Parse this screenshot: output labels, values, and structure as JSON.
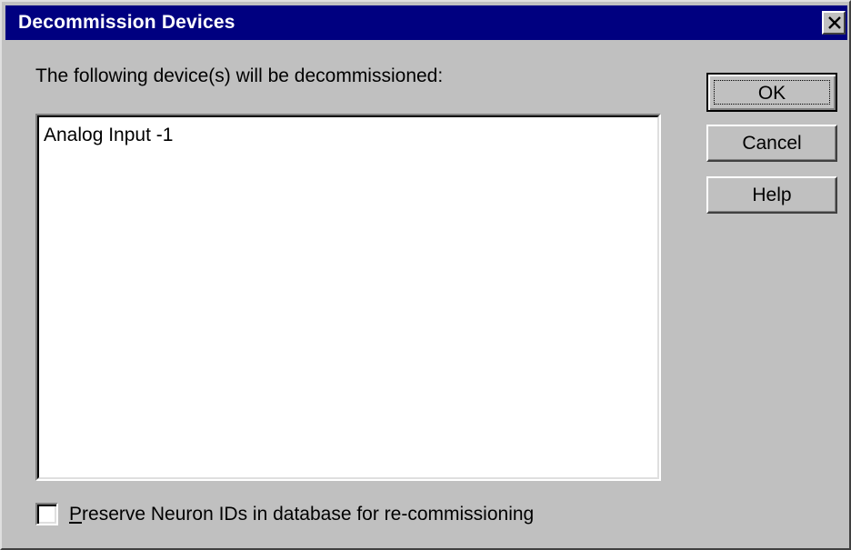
{
  "window": {
    "title": "Decommission Devices",
    "close_glyph": "close-icon"
  },
  "prompt": "The following device(s) will be decommissioned:",
  "devices": [
    "Analog Input -1"
  ],
  "buttons": {
    "ok": "OK",
    "cancel": "Cancel",
    "help": "Help"
  },
  "preserve_option": {
    "mnemonic": "P",
    "label_rest": "reserve Neuron IDs in database for re-commissioning",
    "checked": false
  },
  "colors": {
    "title_bar": "#000080",
    "face": "#c0c0c0"
  }
}
